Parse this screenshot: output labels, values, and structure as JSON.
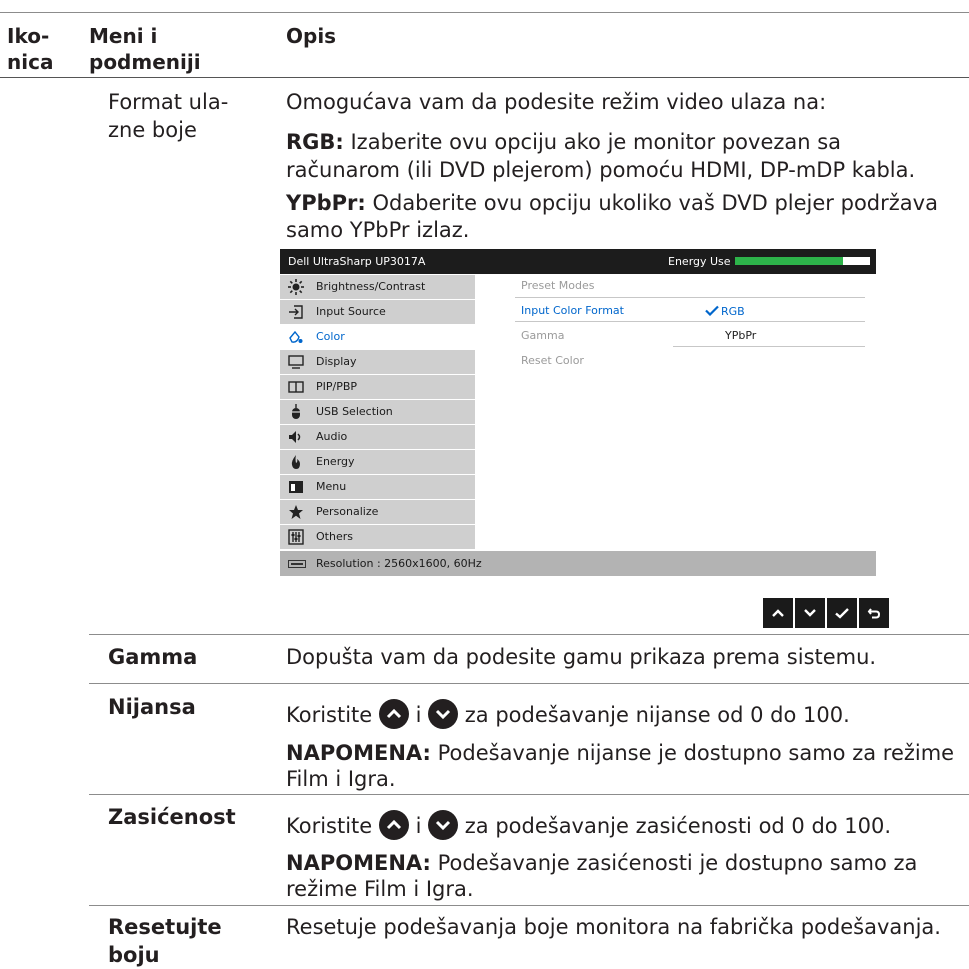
{
  "header": {
    "col1": "Iko-\nnica",
    "col1_a": "Iko-",
    "col1_b": "nica",
    "col2_a": "Meni i",
    "col2_b": "podmeniji",
    "col3": "Opis"
  },
  "rows": {
    "format": {
      "title_a": "Format ula-",
      "title_b": "zne boje",
      "intro": "Omogućava vam da podesite režim video ulaza na:",
      "rgb_label": "RGB:",
      "rgb_text_a": " Izaberite ovu opciju ako je monitor povezan sa",
      "rgb_text_b": "računarom (ili DVD plejerom) pomoću HDMI, DP-mDP kabla.",
      "ypbpr_label": "YPbPr:",
      "ypbpr_text_a": " Odaberite ovu opciju ukoliko vaš DVD plejer podržava",
      "ypbpr_text_b": "samo YPbPr izlaz."
    },
    "gamma": {
      "title": "Gamma",
      "text": "Dopušta vam da podesite gamu prikaza prema sistemu."
    },
    "nijansa": {
      "title": "Nijansa",
      "text_pre": "Koristite ",
      "text_mid": " i ",
      "text_post": " za podešavanje nijanse od 0 do 100.",
      "note_label": "NAPOMENA:",
      "note_text_a": " Podešavanje nijanse je dostupno samo za režime",
      "note_text_b": "Film i Igra."
    },
    "zasicenost": {
      "title": "Zasićenost",
      "text_pre": "Koristite ",
      "text_mid": " i ",
      "text_post": "  za podešavanje zasićenosti od 0 do 100.",
      "note_label": "NAPOMENA:",
      "note_text_a": " Podešavanje zasićenosti je dostupno samo za",
      "note_text_b": "režime Film i Igra."
    },
    "reset": {
      "title_a": "Resetujte",
      "title_b": "boju",
      "text": "Resetuje podešavanja boje monitora na fabrička podešavanja."
    }
  },
  "osd": {
    "title": "Dell UltraSharp UP3017A",
    "energy_label": "Energy Use",
    "energy_level": 0.8,
    "menu": [
      {
        "label": "Brightness/Contrast",
        "icon": "brightness-icon"
      },
      {
        "label": "Input Source",
        "icon": "input-source-icon"
      },
      {
        "label": "Color",
        "icon": "color-icon",
        "selected": true
      },
      {
        "label": "Display",
        "icon": "display-icon"
      },
      {
        "label": "PIP/PBP",
        "icon": "pip-icon"
      },
      {
        "label": "USB Selection",
        "icon": "usb-icon"
      },
      {
        "label": "Audio",
        "icon": "audio-icon"
      },
      {
        "label": "Energy",
        "icon": "energy-icon"
      },
      {
        "label": "Menu",
        "icon": "menu-icon"
      },
      {
        "label": "Personalize",
        "icon": "star-icon"
      },
      {
        "label": "Others",
        "icon": "others-icon"
      }
    ],
    "submenu": [
      "Preset Modes",
      "Input Color Format",
      "Gamma",
      "Reset Color"
    ],
    "options": {
      "rgb": "RGB",
      "ypbpr": "YPbPr"
    },
    "resolution": "Resolution : 2560x1600, 60Hz",
    "accent": "#0066cc",
    "energy_color": "#2db34a"
  },
  "nav_buttons": [
    "up-arrow-icon",
    "down-arrow-icon",
    "check-icon",
    "back-icon"
  ]
}
